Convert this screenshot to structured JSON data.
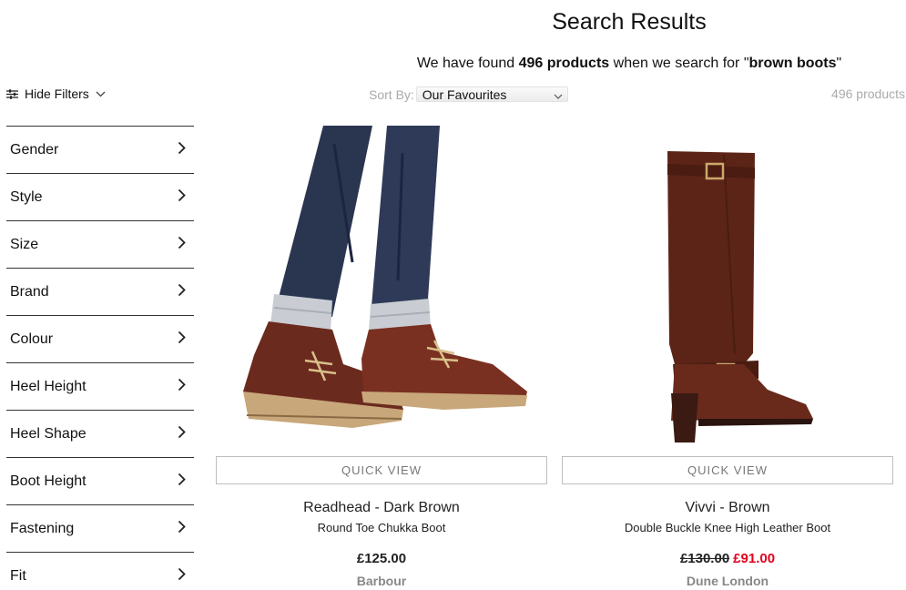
{
  "header": {
    "title": "Search Results",
    "summary_prefix": "We have found ",
    "summary_count": "496 products",
    "summary_middle": " when we search for \"",
    "summary_query": "brown boots",
    "summary_suffix": "\""
  },
  "toolbar": {
    "hide_filters_label": "Hide Filters",
    "sort_label": "Sort By:",
    "sort_value": "Our Favourites",
    "product_count": "496 products"
  },
  "filters": [
    {
      "label": "Gender"
    },
    {
      "label": "Style"
    },
    {
      "label": "Size"
    },
    {
      "label": "Brand"
    },
    {
      "label": "Colour"
    },
    {
      "label": "Heel Height"
    },
    {
      "label": "Heel Shape"
    },
    {
      "label": "Boot Height"
    },
    {
      "label": "Fastening"
    },
    {
      "label": "Fit"
    }
  ],
  "products": [
    {
      "quick_view": "QUICK VIEW",
      "name": "Readhead - Dark Brown",
      "subtitle": "Round Toe Chukka Boot",
      "price": "£125.00",
      "brand": "Barbour"
    },
    {
      "quick_view": "QUICK VIEW",
      "name": "Vivvi - Brown",
      "subtitle": "Double Buckle Knee High Leather Boot",
      "was_price": "£130.00",
      "sale_price": "£91.00",
      "brand": "Dune London"
    }
  ],
  "colors": {
    "sale": "#e3001b",
    "muted": "#888888",
    "divider": "#333333"
  }
}
